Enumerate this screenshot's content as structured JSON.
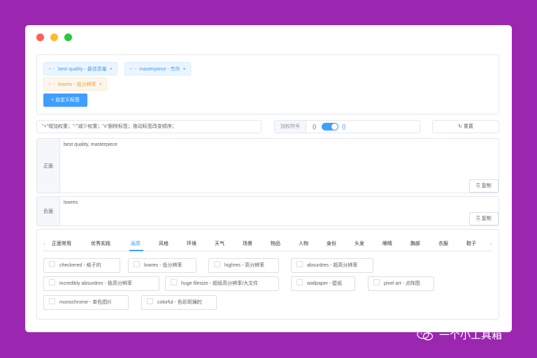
{
  "tags": {
    "positive": [
      {
        "label": "best quality - 最佳质量"
      },
      {
        "label": "masterpiece - 杰作"
      }
    ],
    "negative": [
      {
        "label": "lowres - 低分辨率"
      }
    ],
    "controls": "+ −",
    "close": "×",
    "custom_button": "+ 自定义标签"
  },
  "hint": "\"+\"增加权重；\"-\"减少权重；\"x\"删除标签；拖动标签改变顺序；",
  "weight": {
    "label": "加权符号",
    "paren_left": "()",
    "paren_right": "{}"
  },
  "reset": "↻ 重置",
  "positive": {
    "label": "正面",
    "text": "best quality, masterpiece",
    "copy": "复制"
  },
  "negative": {
    "label": "负面",
    "text": "lowres",
    "copy": "复制"
  },
  "tabs": [
    "正面常用",
    "优秀实践",
    "画质",
    "风格",
    "环境",
    "天气",
    "场景",
    "物品",
    "人物",
    "身份",
    "头发",
    "眼睛",
    "胸部",
    "衣服",
    "鞋子"
  ],
  "active_tab": "画质",
  "options": [
    "checkered - 格子的",
    "lowres - 低分辨率",
    "highres - 高分辨率",
    "absurdres - 超高分辨率",
    "incredibly absurdres - 极高分辨率",
    "huge filesize - 超级高分辨率/大文件",
    "wallpaper - 壁纸",
    "pixel art - 点阵图",
    "monochrome - 单色图片",
    "colorful - 色彩斑斓的"
  ],
  "watermark": "一个小工具箱",
  "colors": {
    "accent": "#409eff",
    "background": "#9b27b0",
    "warning": "#e6a23c"
  }
}
